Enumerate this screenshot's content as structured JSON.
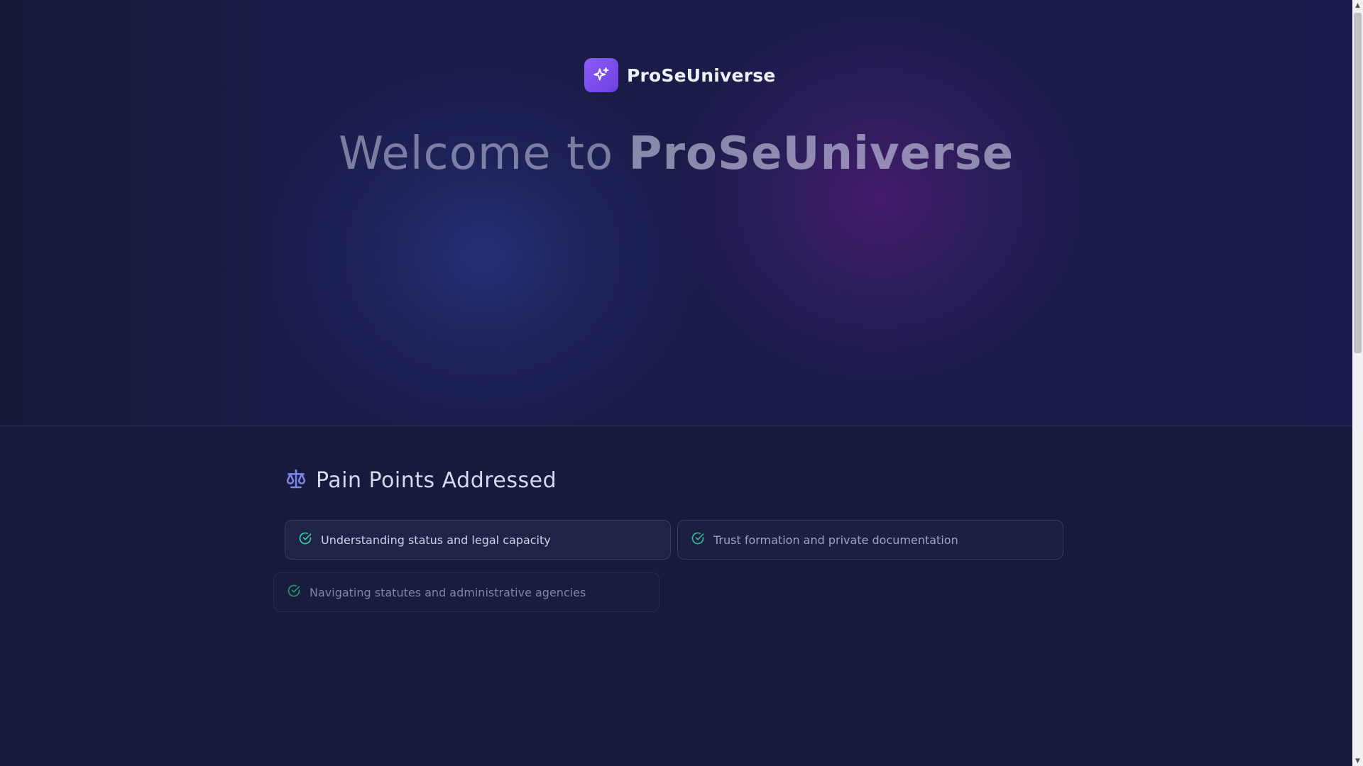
{
  "brand": {
    "name": "ProSeUniverse",
    "logo_icon": "sparkles-icon",
    "logo_gradient": [
      "#8b5cf6",
      "#6d3fe0"
    ]
  },
  "hero": {
    "title_prefix": "Welcome to ",
    "title_emphasis": "ProSeUniverse"
  },
  "pain_points": {
    "icon": "scale-icon",
    "title": "Pain Points Addressed",
    "items": [
      {
        "label": "Understanding status and legal capacity",
        "icon": "check-circle-icon"
      },
      {
        "label": "Trust formation and private documentation",
        "icon": "check-circle-icon"
      },
      {
        "label": "Navigating statutes and administrative agencies",
        "icon": "check-circle-icon"
      }
    ]
  },
  "colors": {
    "accent": "#8b5cf6",
    "check": "#34d399",
    "background": "#161a3c"
  }
}
